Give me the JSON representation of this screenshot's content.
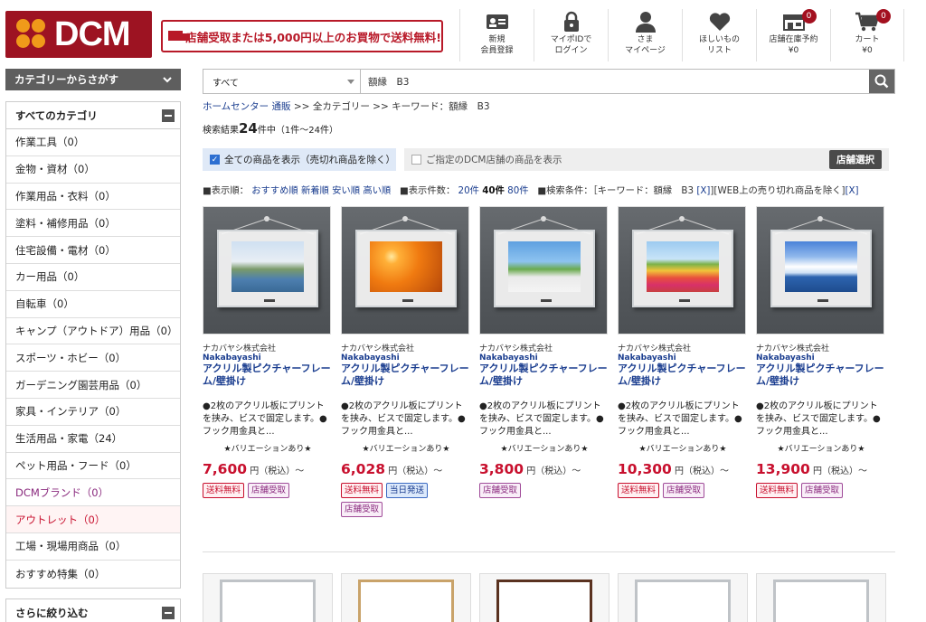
{
  "logo": {
    "text": "DCM"
  },
  "promo": {
    "text": "店舗受取または5,000円以上のお買物で送料無料!"
  },
  "header_nav": [
    {
      "label1": "新規",
      "label2": "会員登録",
      "icon": "member-card-icon"
    },
    {
      "label1": "マイポIDで",
      "label2": "ログイン",
      "icon": "lock-icon"
    },
    {
      "label1": "さま",
      "label2": "マイページ",
      "icon": "person-icon"
    },
    {
      "label1": "ほしいもの",
      "label2": "リスト",
      "icon": "heart-icon"
    },
    {
      "label1": "店舗在庫予約",
      "label2": "¥0",
      "icon": "store-icon",
      "badge": "0"
    },
    {
      "label1": "カート",
      "label2": "¥0",
      "icon": "cart-icon",
      "badge": "0"
    }
  ],
  "sidebar": {
    "category_bar": "カテゴリーからさがす",
    "all_title": "すべてのカテゴリ",
    "items": [
      "作業工具（0）",
      "金物・資材（0）",
      "作業用品・衣料（0）",
      "塗料・補修用品（0）",
      "住宅設備・電材（0）",
      "カー用品（0）",
      "自転車（0）",
      "キャンプ（アウトドア）用品（0）",
      "スポーツ・ホビー（0）",
      "ガーデニング園芸用品（0）",
      "家具・インテリア（0）",
      "生活用品・家電（24）",
      "ペット用品・フード（0）",
      "DCMブランド（0）",
      "アウトレット（0）",
      "工場・現場用商品（0）",
      "おすすめ特集（0）"
    ],
    "refine_title": "さらに絞り込む"
  },
  "search": {
    "category": "すべて",
    "query": "額縁　B3"
  },
  "breadcrumb": {
    "home": "ホームセンター 通販",
    "sep1": ">>",
    "all": "全カテゴリー",
    "sep2": ">>",
    "keyword": "キーワード：額縁　B3"
  },
  "results": {
    "prefix": "検索結果",
    "count": "24",
    "suffix": "件中（1件〜24件）"
  },
  "filters": {
    "show_all": "全ての商品を表示（売切れ商品を除く）",
    "store_only": "ご指定のDCM店舗の商品を表示",
    "store_button": "店舗選択"
  },
  "sort": {
    "label": "■表示順：",
    "opts": [
      "おすすめ順",
      "新着順",
      "安い順",
      "高い順"
    ],
    "count_label": "■表示件数：",
    "counts": [
      "20件",
      "40件",
      "80件"
    ],
    "cond": "■検索条件：［キーワード：額縁　B3",
    "x1": "[X]",
    "cond2": "][WEB上の売り切れ商品を除く]",
    "x2": "[X]"
  },
  "products": [
    {
      "maker": "ナカバヤシ株式会社",
      "brand": "Nakabayashi",
      "name": "アクリル製ピクチャーフレーム/壁掛け",
      "desc": "●2枚のアクリル板にプリントを挟み、ビスで固定します。●フック用金具と...",
      "variation": "★バリエーションあり★",
      "price": "7,600",
      "unit": "円（税込）～",
      "tags": [
        "送料無料",
        "店舗受取"
      ]
    },
    {
      "maker": "ナカバヤシ株式会社",
      "brand": "Nakabayashi",
      "name": "アクリル製ピクチャーフレーム/壁掛け",
      "desc": "●2枚のアクリル板にプリントを挟み、ビスで固定します。●フック用金具と...",
      "variation": "★バリエーションあり★",
      "price": "6,028",
      "unit": "円（税込）～",
      "tags": [
        "送料無料",
        "当日発送",
        "店舗受取"
      ]
    },
    {
      "maker": "ナカバヤシ株式会社",
      "brand": "Nakabayashi",
      "name": "アクリル製ピクチャーフレーム/壁掛け",
      "desc": "●2枚のアクリル板にプリントを挟み、ビスで固定します。●フック用金具と...",
      "variation": "★バリエーションあり★",
      "price": "3,800",
      "unit": "円（税込）～",
      "tags": [
        "店舗受取"
      ]
    },
    {
      "maker": "ナカバヤシ株式会社",
      "brand": "Nakabayashi",
      "name": "アクリル製ピクチャーフレーム/壁掛け",
      "desc": "●2枚のアクリル板にプリントを挟み、ビスで固定します。●フック用金具と...",
      "variation": "★バリエーションあり★",
      "price": "10,300",
      "unit": "円（税込）～",
      "tags": [
        "送料無料",
        "店舗受取"
      ]
    },
    {
      "maker": "ナカバヤシ株式会社",
      "brand": "Nakabayashi",
      "name": "アクリル製ピクチャーフレーム/壁掛け",
      "desc": "●2枚のアクリル板にプリントを挟み、ビスで固定します。●フック用金具と...",
      "variation": "★バリエーションあり★",
      "price": "13,900",
      "unit": "円（税込）～",
      "tags": [
        "送料無料",
        "店舗受取"
      ]
    }
  ],
  "colors": {
    "brand_red": "#9d1322",
    "price_red": "#c8102e",
    "link_blue": "#1a3d8f",
    "logo_orange": "#f09a1a"
  }
}
